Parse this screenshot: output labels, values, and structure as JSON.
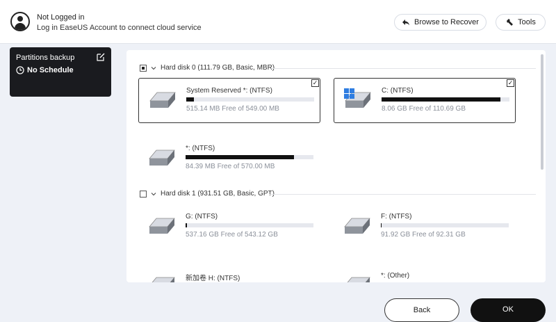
{
  "header": {
    "user_title": "Not Logged in",
    "user_subtitle": "Log in EaseUS Account to connect cloud service",
    "browse_label": "Browse to Recover",
    "tools_label": "Tools"
  },
  "sidebar": {
    "card_title": "Partitions backup",
    "schedule": "No Schedule"
  },
  "disks": [
    {
      "label": "Hard disk 0 (111.79 GB, Basic, MBR)",
      "check_state": "partial",
      "partitions": [
        {
          "name": "System Reserved *: (NTFS)",
          "free": "515.14 MB Free of 549.00 MB",
          "used_fraction": 0.06,
          "selected": true,
          "icon": "drive-icon"
        },
        {
          "name": "C: (NTFS)",
          "free": "8.06 GB Free of 110.69 GB",
          "used_fraction": 0.93,
          "selected": true,
          "icon": "windows-drive-icon"
        },
        {
          "name": "*: (NTFS)",
          "free": "84.39 MB Free of 570.00 MB",
          "used_fraction": 0.85,
          "selected": false,
          "icon": "drive-icon"
        }
      ]
    },
    {
      "label": "Hard disk 1 (931.51 GB, Basic, GPT)",
      "check_state": "unchecked",
      "partitions": [
        {
          "name": "G: (NTFS)",
          "free": "537.16 GB Free of 543.12 GB",
          "used_fraction": 0.01,
          "selected": false,
          "icon": "drive-icon"
        },
        {
          "name": "F: (NTFS)",
          "free": "91.92 GB Free of 92.31 GB",
          "used_fraction": 0.005,
          "selected": false,
          "icon": "drive-icon"
        },
        {
          "name": "新加卷 H: (NTFS)",
          "free": "",
          "used_fraction": 0,
          "selected": false,
          "icon": "drive-icon"
        },
        {
          "name": "*: (Other)",
          "free": "",
          "used_fraction": 0,
          "selected": false,
          "icon": "drive-icon"
        }
      ]
    }
  ],
  "footer": {
    "back_label": "Back",
    "ok_label": "OK"
  }
}
